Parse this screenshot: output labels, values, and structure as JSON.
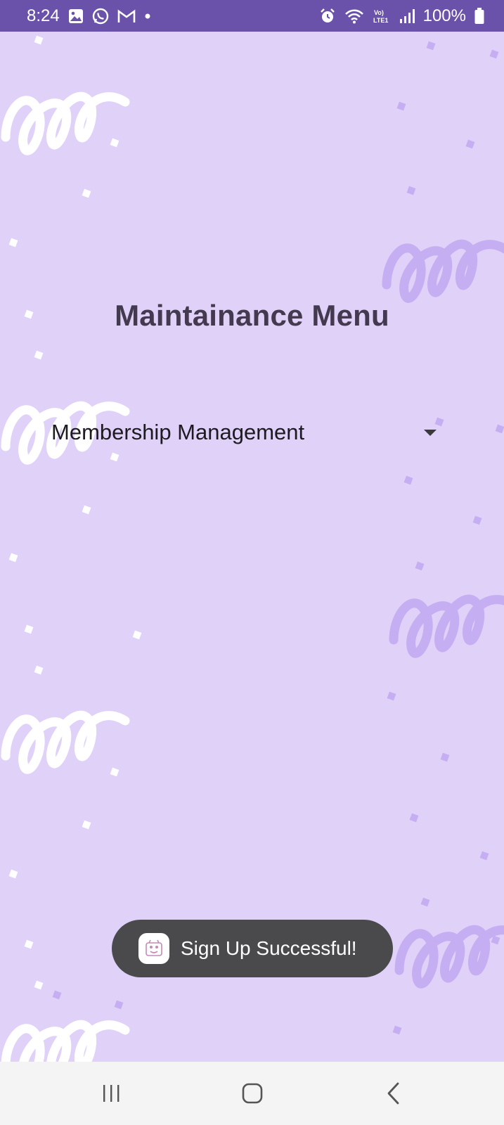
{
  "status_bar": {
    "time": "8:24",
    "battery": "100%",
    "icons_left": [
      "gallery-icon",
      "whatsapp-icon",
      "gmail-icon",
      "dot-icon"
    ],
    "icons_right": [
      "alarm-icon",
      "wifi-icon",
      "volte-icon",
      "signal-icon",
      "battery-icon"
    ]
  },
  "main": {
    "title": "Maintainance Menu",
    "dropdown": {
      "selected": "Membership Management"
    }
  },
  "toast": {
    "message": "Sign Up Successful!"
  },
  "nav_bar": {
    "buttons": [
      "recent-apps",
      "home",
      "back"
    ]
  },
  "colors": {
    "background": "#e0d1f9",
    "status_bar": "#6a51a9",
    "title": "#433a4f",
    "toast_bg": "#4a4a4c",
    "decor_white": "#ffffff",
    "decor_purple": "#c6aef2"
  }
}
